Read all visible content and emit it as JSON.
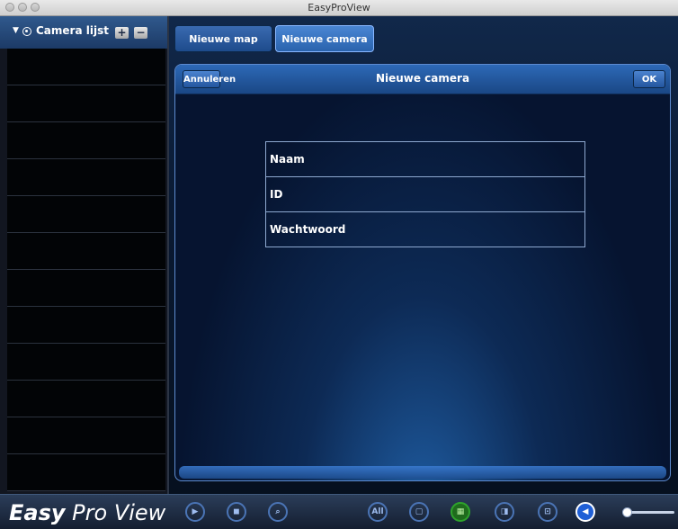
{
  "window": {
    "title": "EasyProView"
  },
  "sidebar": {
    "header_label": "Camera lijst",
    "add_button": "+",
    "remove_button": "−",
    "row_count": 12
  },
  "tabs": [
    {
      "label": "Nieuwe map",
      "active": false
    },
    {
      "label": "Nieuwe camera",
      "active": true
    }
  ],
  "dialog": {
    "title": "Nieuwe camera",
    "cancel_label": "Annuleren",
    "ok_label": "OK",
    "fields": [
      {
        "label": "Naam"
      },
      {
        "label": "ID"
      },
      {
        "label": "Wachtwoord"
      }
    ]
  },
  "bottom": {
    "logo_bold": "Easy",
    "logo_rest": " Pro View",
    "all_label": "All",
    "icons": [
      "play-icon",
      "camera-icon",
      "search-icon",
      "all-icon",
      "single-view-icon",
      "quad-view-icon",
      "split-view-icon",
      "fullscreen-icon",
      "speaker-icon"
    ]
  },
  "colors": {
    "accent": "#2a63ad",
    "active_green": "#1f6b1d"
  }
}
